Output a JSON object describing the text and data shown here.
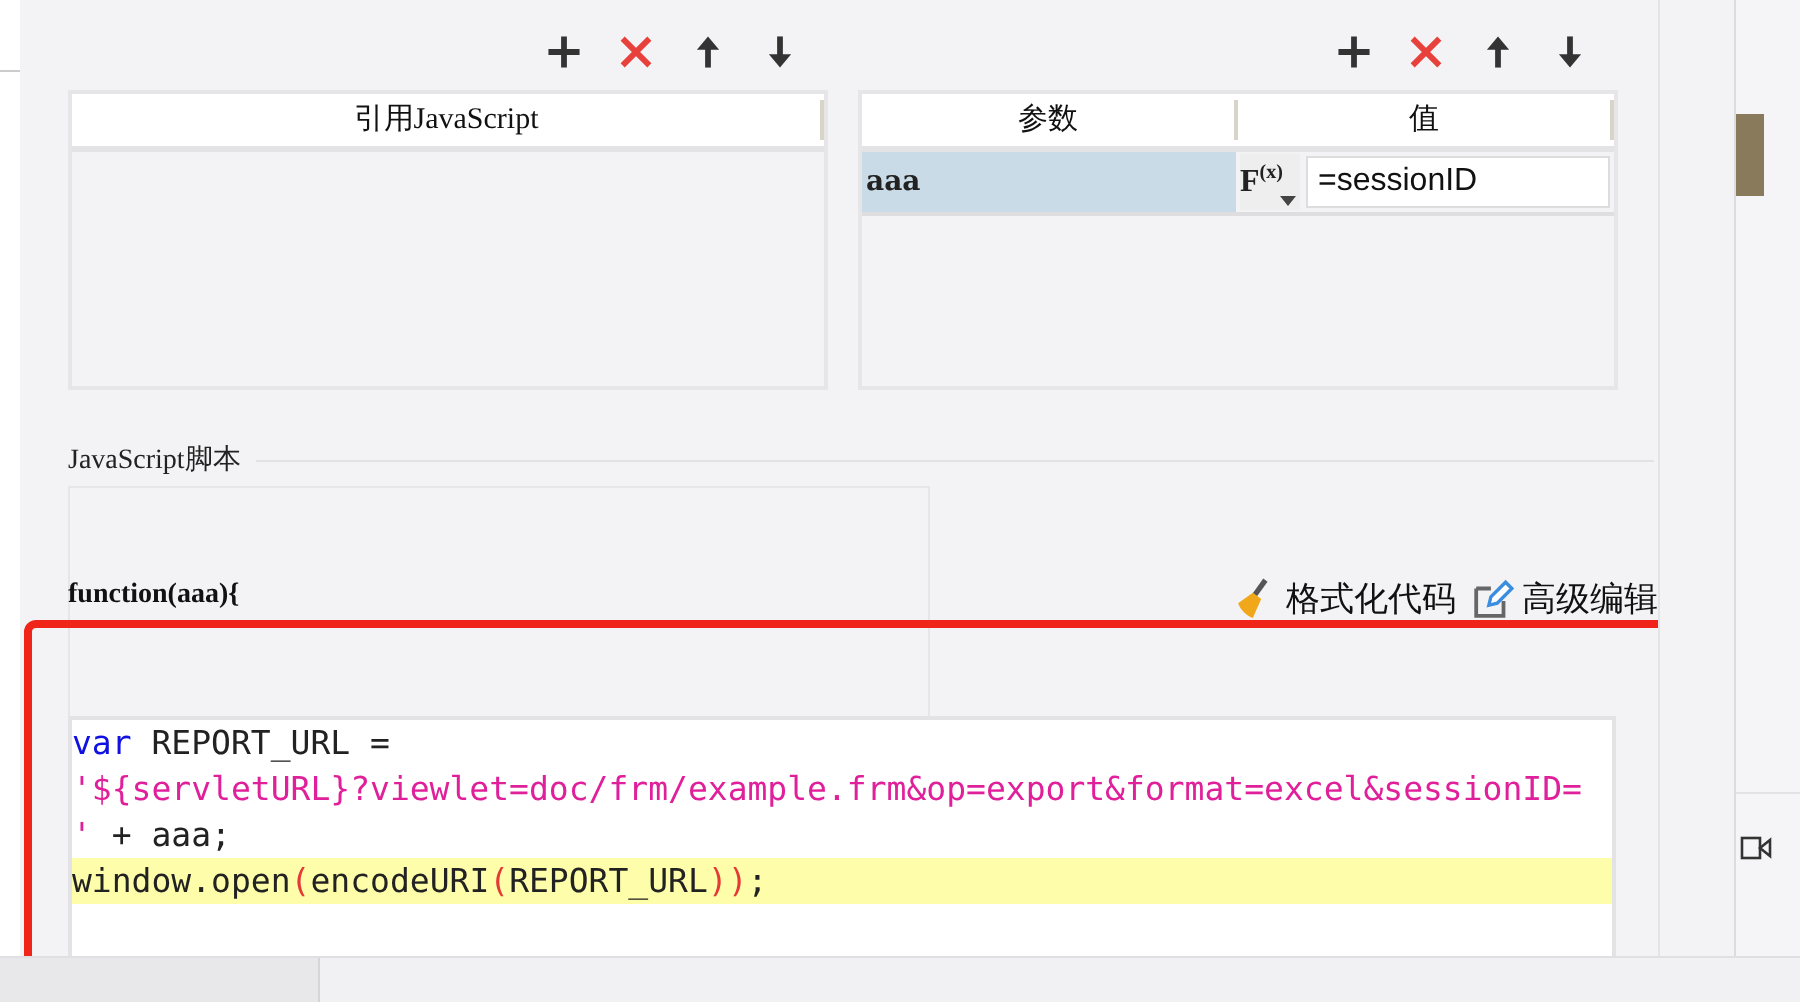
{
  "reference_panel": {
    "table": {
      "columns": [
        "引用JavaScript"
      ]
    }
  },
  "parameter_panel": {
    "table": {
      "columns": [
        "参数",
        "值"
      ],
      "rows": [
        {
          "name": "aaa",
          "selected": true,
          "formula_button": "F$^{(x)}$",
          "value": "=sessionID"
        }
      ]
    }
  },
  "script_section": {
    "title": "JavaScript脚本",
    "signature": "function(aaa){",
    "actions": [
      {
        "kind": "format",
        "label": "格式化代码"
      },
      {
        "kind": "edit",
        "label": "高级编辑"
      }
    ],
    "editor": {
      "lines": [
        {
          "highlighted": false,
          "tokens": [
            {
              "kind": "keyword",
              "text": "var"
            },
            {
              "kind": "plain",
              "text": " REPORT_URL ="
            }
          ]
        },
        {
          "highlighted": false,
          "tokens": [
            {
              "kind": "string",
              "text": "'${servletURL}?viewlet=doc/frm/example.frm&op=export&format=excel&sessionID="
            }
          ]
        },
        {
          "highlighted": false,
          "tokens": [
            {
              "kind": "string",
              "text": "'"
            },
            {
              "kind": "plain",
              "text": " + aaa;"
            }
          ]
        },
        {
          "highlighted": true,
          "tokens": [
            {
              "kind": "plain",
              "text": "window.open"
            },
            {
              "kind": "paren",
              "text": "("
            },
            {
              "kind": "plain",
              "text": "encodeURI"
            },
            {
              "kind": "paren",
              "text": "("
            },
            {
              "kind": "plain",
              "text": "REPORT_URL"
            },
            {
              "kind": "paren",
              "text": "))"
            },
            {
              "kind": "plain",
              "text": ";"
            }
          ]
        }
      ]
    }
  }
}
